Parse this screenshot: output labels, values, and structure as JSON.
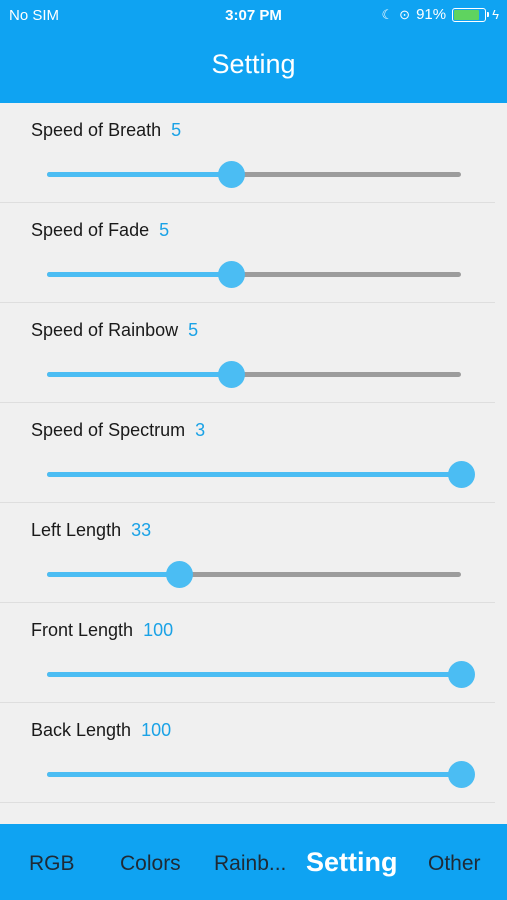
{
  "status": {
    "carrier": "No SIM",
    "time": "3:07 PM",
    "battery": "91%",
    "battery_level": 0.91,
    "icons": [
      "moon-icon",
      "rotation-lock-icon",
      "battery-icon",
      "charging-bolt-icon"
    ]
  },
  "header": {
    "title": "Setting"
  },
  "settings": [
    {
      "label": "Speed of Breath",
      "value": "5",
      "fraction": 0.445
    },
    {
      "label": "Speed of Fade",
      "value": "5",
      "fraction": 0.445
    },
    {
      "label": "Speed of Rainbow",
      "value": "5",
      "fraction": 0.445
    },
    {
      "label": "Speed of Spectrum",
      "value": "3",
      "fraction": 1.0
    },
    {
      "label": "Left Length",
      "value": "33",
      "fraction": 0.32
    },
    {
      "label": "Front Length",
      "value": "100",
      "fraction": 1.0
    },
    {
      "label": "Back Length",
      "value": "100",
      "fraction": 1.0
    }
  ],
  "tabs": [
    {
      "label": "RGB",
      "active": false
    },
    {
      "label": "Colors",
      "active": false
    },
    {
      "label": "Rainb...",
      "active": false
    },
    {
      "label": "Setting",
      "active": true
    },
    {
      "label": "Other",
      "active": false
    }
  ],
  "colors": {
    "accent": "#0fa3f2",
    "slider": "#4bbdf3",
    "track": "#9c9c9c",
    "value_text": "#1aa2e6"
  }
}
